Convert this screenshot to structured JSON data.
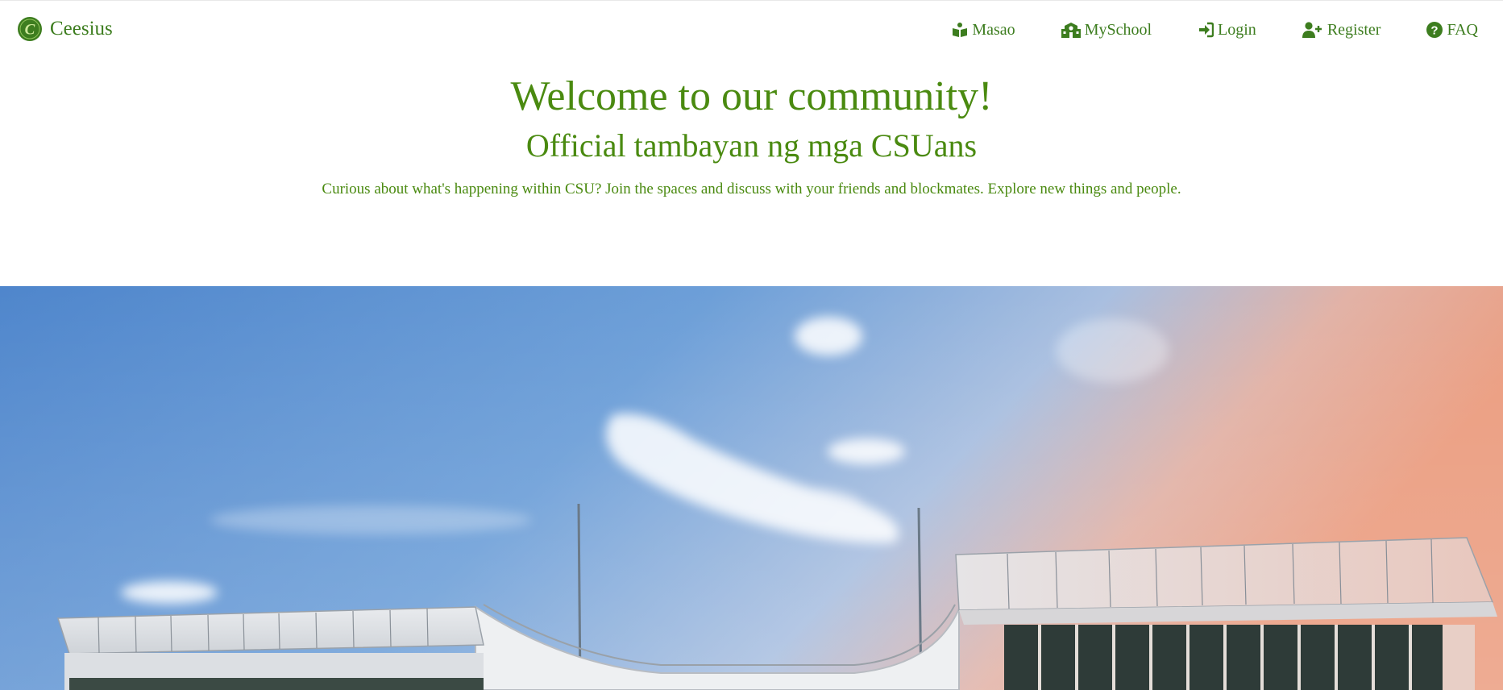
{
  "brand": {
    "name": "Ceesius",
    "logo_letter": "C",
    "logo_icon": "ceesius-logo-icon"
  },
  "nav": [
    {
      "label": "Masao",
      "icon": "book-reader-icon"
    },
    {
      "label": "MySchool",
      "icon": "school-icon"
    },
    {
      "label": "Login",
      "icon": "sign-in-icon"
    },
    {
      "label": "Register",
      "icon": "user-plus-icon"
    },
    {
      "label": "FAQ",
      "icon": "question-circle-icon"
    }
  ],
  "hero": {
    "title": "Welcome to our community!",
    "subtitle": "Official tambayan ng mga CSUans",
    "description": "Curious about what's happening within CSU? Join the spaces and discuss with your friends and blockmates. Explore new things and people."
  },
  "colors": {
    "brand_green": "#3d7d1f",
    "text_green": "#4a8a10",
    "sky_blue": "#5b93d2",
    "sunset_orange": "#e8a088"
  }
}
